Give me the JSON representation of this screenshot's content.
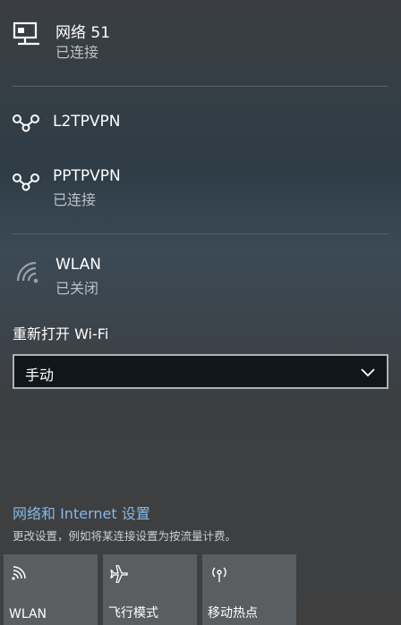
{
  "networks": [
    {
      "name": "网络 51",
      "status": "已连接",
      "icon": "ethernet-icon"
    },
    {
      "name": "L2TPVPN",
      "status": "",
      "icon": "vpn-icon"
    },
    {
      "name": "PPTPVPN",
      "status": "已连接",
      "icon": "vpn-icon"
    },
    {
      "name": "WLAN",
      "status": "已关闭",
      "icon": "wifi-icon"
    }
  ],
  "wifi_reenable": {
    "label": "重新打开 Wi-Fi",
    "selected": "手动"
  },
  "settings": {
    "link": "网络和 Internet 设置",
    "hint": "更改设置，例如将某连接设置为按流量计费。"
  },
  "quick_actions": [
    {
      "label": "WLAN",
      "icon": "wifi-icon"
    },
    {
      "label": "飞行模式",
      "icon": "airplane-icon"
    },
    {
      "label": "移动热点",
      "icon": "hotspot-icon"
    }
  ]
}
